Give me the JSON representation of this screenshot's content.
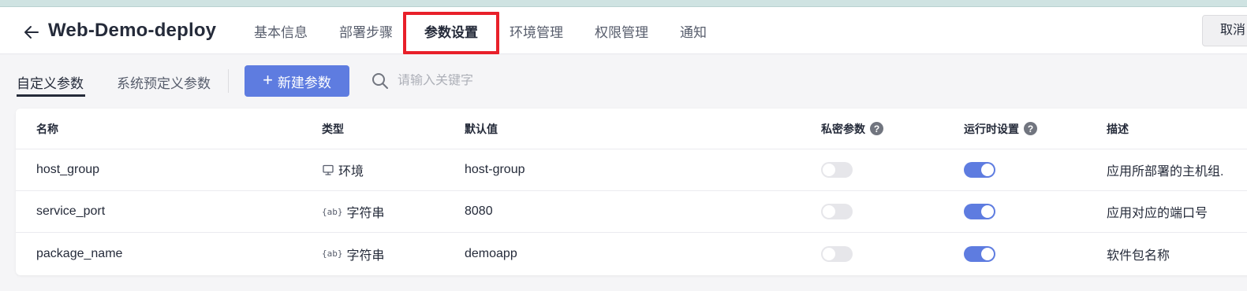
{
  "header": {
    "title": "Web-Demo-deploy",
    "tabs": [
      {
        "label": "基本信息"
      },
      {
        "label": "部署步骤"
      },
      {
        "label": "参数设置"
      },
      {
        "label": "环境管理"
      },
      {
        "label": "权限管理"
      },
      {
        "label": "通知"
      }
    ],
    "active_tab": "参数设置",
    "cancel_label": "取消"
  },
  "subbar": {
    "tabs": [
      "自定义参数",
      "系统预定义参数"
    ],
    "new_button_label": "新建参数",
    "search_placeholder": "请输入关键字"
  },
  "table": {
    "columns": [
      "名称",
      "类型",
      "默认值",
      "私密参数",
      "运行时设置",
      "描述"
    ],
    "rows": [
      {
        "name": "host_group",
        "type": "环境",
        "type_icon": "monitor-icon",
        "default": "host-group",
        "secret": false,
        "runtime": true,
        "desc": "应用所部署的主机组."
      },
      {
        "name": "service_port",
        "type": "字符串",
        "type_icon": "string-icon",
        "default": "8080",
        "secret": false,
        "runtime": true,
        "desc": "应用对应的端口号"
      },
      {
        "name": "package_name",
        "type": "字符串",
        "type_icon": "string-icon",
        "default": "demoapp",
        "secret": false,
        "runtime": true,
        "desc": "软件包名称"
      }
    ]
  },
  "colors": {
    "primary": "#5e7ce0",
    "highlight_box": "#e8202a",
    "top_strip": "#cfe3e2"
  }
}
